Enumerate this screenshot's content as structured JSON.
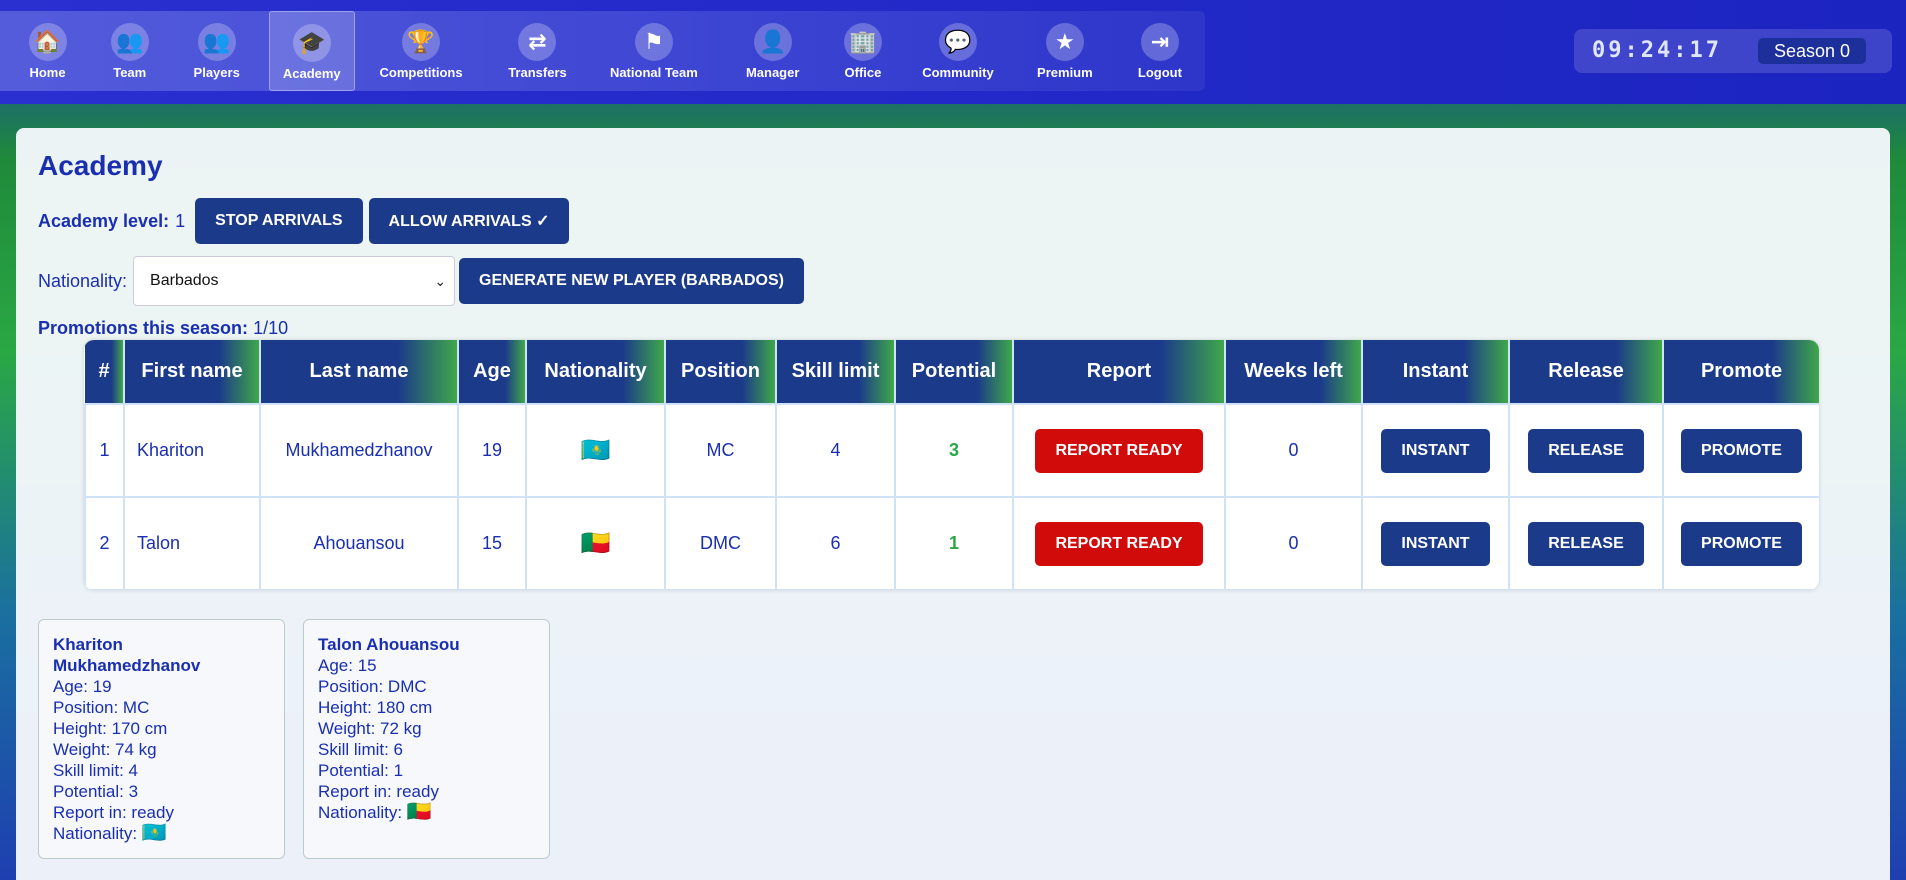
{
  "nav": {
    "items": [
      {
        "label": "Home",
        "icon": "🏠",
        "icon_name": "home-icon"
      },
      {
        "label": "Team",
        "icon": "👥",
        "icon_name": "team-icon"
      },
      {
        "label": "Players",
        "icon": "👥",
        "icon_name": "players-icon"
      },
      {
        "label": "Academy",
        "icon": "🎓",
        "icon_name": "academy-icon"
      },
      {
        "label": "Competitions",
        "icon": "🏆",
        "icon_name": "trophy-icon"
      },
      {
        "label": "Transfers",
        "icon": "⇄",
        "icon_name": "transfers-icon"
      },
      {
        "label": "National Team",
        "icon": "⚑",
        "icon_name": "flag-icon"
      },
      {
        "label": "Manager",
        "icon": "👤",
        "icon_name": "manager-icon"
      },
      {
        "label": "Office",
        "icon": "🏢",
        "icon_name": "office-icon"
      },
      {
        "label": "Community",
        "icon": "💬",
        "icon_name": "community-icon"
      },
      {
        "label": "Premium",
        "icon": "★",
        "icon_name": "star-icon"
      },
      {
        "label": "Logout",
        "icon": "⇥",
        "icon_name": "logout-icon"
      }
    ],
    "active": "Academy"
  },
  "header": {
    "clock": "09:24:17",
    "season": "Season 0"
  },
  "page": {
    "title": "Academy",
    "academy_level_label": "Academy level:",
    "academy_level_value": "1",
    "stop_arrivals": "STOP ARRIVALS",
    "allow_arrivals": "ALLOW ARRIVALS ✓",
    "nationality_label": "Nationality:",
    "nationality_value": "Barbados",
    "generate_button": "GENERATE NEW PLAYER (BARBADOS)",
    "promotions_label": "Promotions this season:",
    "promotions_value": "1/10"
  },
  "table": {
    "headers": [
      "#",
      "First name",
      "Last name",
      "Age",
      "Nationality",
      "Position",
      "Skill limit",
      "Potential",
      "Report",
      "Weeks left",
      "Instant",
      "Release",
      "Promote"
    ],
    "rows": [
      {
        "num": "1",
        "first": "Khariton",
        "last": "Mukhamedzhanov",
        "age": "19",
        "flag": "🇰🇿",
        "position": "MC",
        "skill": "4",
        "potential": "3",
        "report": "REPORT READY",
        "weeks": "0",
        "instant": "INSTANT",
        "release": "RELEASE",
        "promote": "PROMOTE"
      },
      {
        "num": "2",
        "first": "Talon",
        "last": "Ahouansou",
        "age": "15",
        "flag": "🇧🇯",
        "position": "DMC",
        "skill": "6",
        "potential": "1",
        "report": "REPORT READY",
        "weeks": "0",
        "instant": "INSTANT",
        "release": "RELEASE",
        "promote": "PROMOTE"
      }
    ]
  },
  "cards": [
    {
      "name": "Khariton Mukhamedzhanov",
      "age": "Age: 19",
      "position": "Position: MC",
      "height": "Height: 170 cm",
      "weight": "Weight: 74 kg",
      "skill": "Skill limit: 4",
      "potential": "Potential: 3",
      "report": "Report in: ready",
      "nationality": "Nationality:",
      "flag": "🇰🇿"
    },
    {
      "name": "Talon Ahouansou",
      "age": "Age: 15",
      "position": "Position: DMC",
      "height": "Height: 180 cm",
      "weight": "Weight: 72 kg",
      "skill": "Skill limit: 6",
      "potential": "Potential: 1",
      "report": "Report in: ready",
      "nationality": "Nationality:",
      "flag": "🇧🇯"
    }
  ],
  "colors": {
    "primary": "#1c3a8a",
    "danger": "#d10a0a",
    "positive": "#2aa844",
    "text": "#1a2fb0"
  }
}
